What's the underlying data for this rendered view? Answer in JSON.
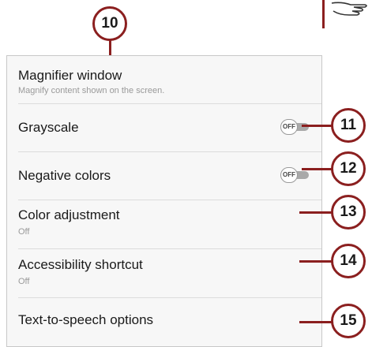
{
  "settings": {
    "magnifier": {
      "title": "Magnifier window",
      "subtitle": "Magnify content shown on the screen."
    },
    "grayscale": {
      "title": "Grayscale",
      "toggle_label": "OFF"
    },
    "negative": {
      "title": "Negative colors",
      "toggle_label": "OFF"
    },
    "color_adjustment": {
      "title": "Color adjustment",
      "value": "Off"
    },
    "accessibility_shortcut": {
      "title": "Accessibility shortcut",
      "value": "Off"
    },
    "tts": {
      "title": "Text-to-speech options"
    }
  },
  "callouts": [
    "10",
    "11",
    "12",
    "13",
    "14",
    "15"
  ],
  "colors": {
    "callout_border": "#8b1f1f",
    "panel_bg": "#f7f7f7",
    "toggle_off": "#a9a9a9"
  },
  "icons": {
    "corner": "pointing-hand-icon"
  }
}
